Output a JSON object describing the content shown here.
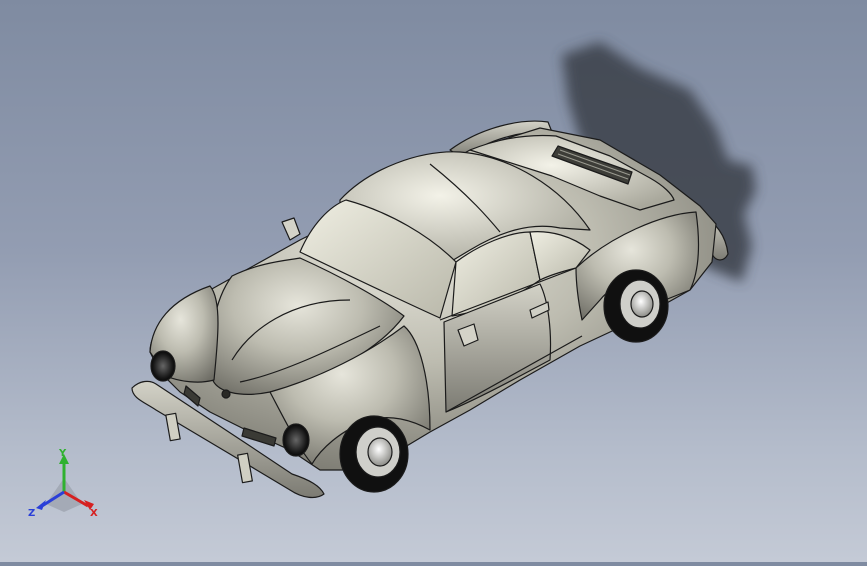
{
  "viewport": {
    "background_top": "#7f8ba1",
    "background_bottom": "#c4cad6",
    "model": {
      "body_color": "#b8b7ab",
      "shadow_color": "#3a3f4a",
      "edge_color": "#1b1b1b"
    }
  },
  "triad": {
    "x_label": "X",
    "y_label": "Y",
    "z_label": "Z",
    "x_color": "#d62020",
    "y_color": "#2fb12f",
    "z_color": "#2a3fd8"
  }
}
